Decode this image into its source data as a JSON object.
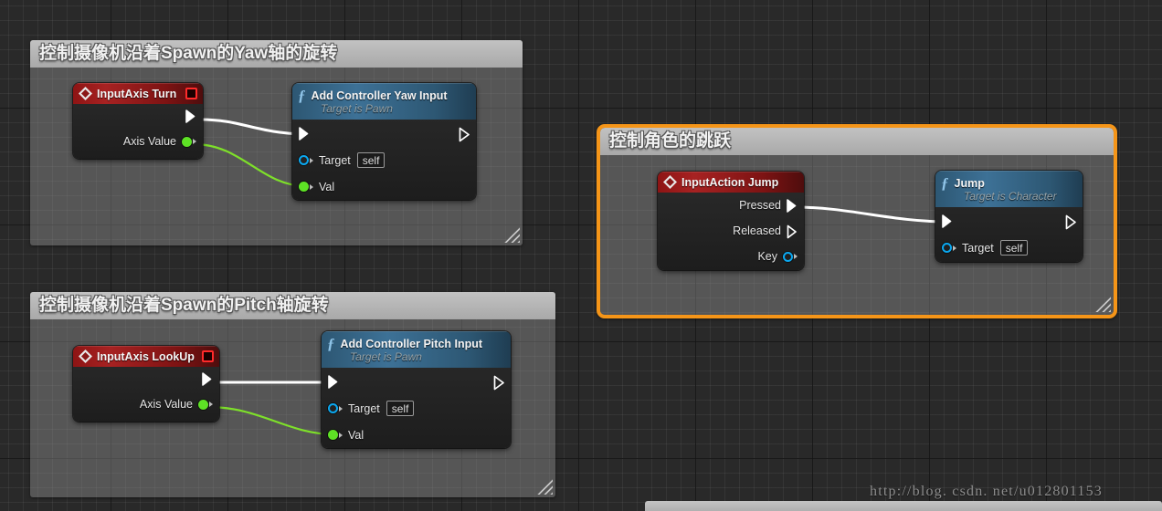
{
  "app": {
    "name": "Unreal Engine Blueprint Editor",
    "watermark": "http://blog. csdn. net/u012801153"
  },
  "comments": [
    {
      "id": "comment-yaw",
      "title": "控制摄像机沿着Spawn的Yaw轴的旋转",
      "selected": false
    },
    {
      "id": "comment-pitch",
      "title": "控制摄像机沿着Spawn的Pitch轴旋转",
      "selected": false
    },
    {
      "id": "comment-jump",
      "title": "控制角色的跳跃",
      "selected": true,
      "border_color": "#f59518"
    }
  ],
  "nodes": {
    "input_axis_turn": {
      "title": "InputAxis Turn",
      "type": "event",
      "pins": {
        "exec_out": "",
        "axis_value": "Axis Value"
      }
    },
    "add_controller_yaw_input": {
      "title": "Add Controller Yaw Input",
      "subtitle": "Target is Pawn",
      "type": "function",
      "pins": {
        "target": "Target",
        "target_value": "self",
        "val": "Val"
      }
    },
    "input_axis_lookup": {
      "title": "InputAxis LookUp",
      "type": "event",
      "pins": {
        "exec_out": "",
        "axis_value": "Axis Value"
      }
    },
    "add_controller_pitch_input": {
      "title": "Add Controller Pitch Input",
      "subtitle": "Target is Pawn",
      "type": "function",
      "pins": {
        "target": "Target",
        "target_value": "self",
        "val": "Val"
      }
    },
    "input_action_jump": {
      "title": "InputAction Jump",
      "type": "event",
      "pins": {
        "pressed": "Pressed",
        "released": "Released",
        "key": "Key"
      }
    },
    "jump": {
      "title": "Jump",
      "subtitle": "Target is Character",
      "type": "function",
      "pins": {
        "target": "Target",
        "target_value": "self"
      }
    }
  },
  "colors": {
    "exec_wire": "#ffffff",
    "float_wire": "#7ee02a",
    "event_header": "#a72222",
    "function_header": "#3d7196",
    "selection": "#f59518",
    "canvas_bg": "#292929"
  }
}
